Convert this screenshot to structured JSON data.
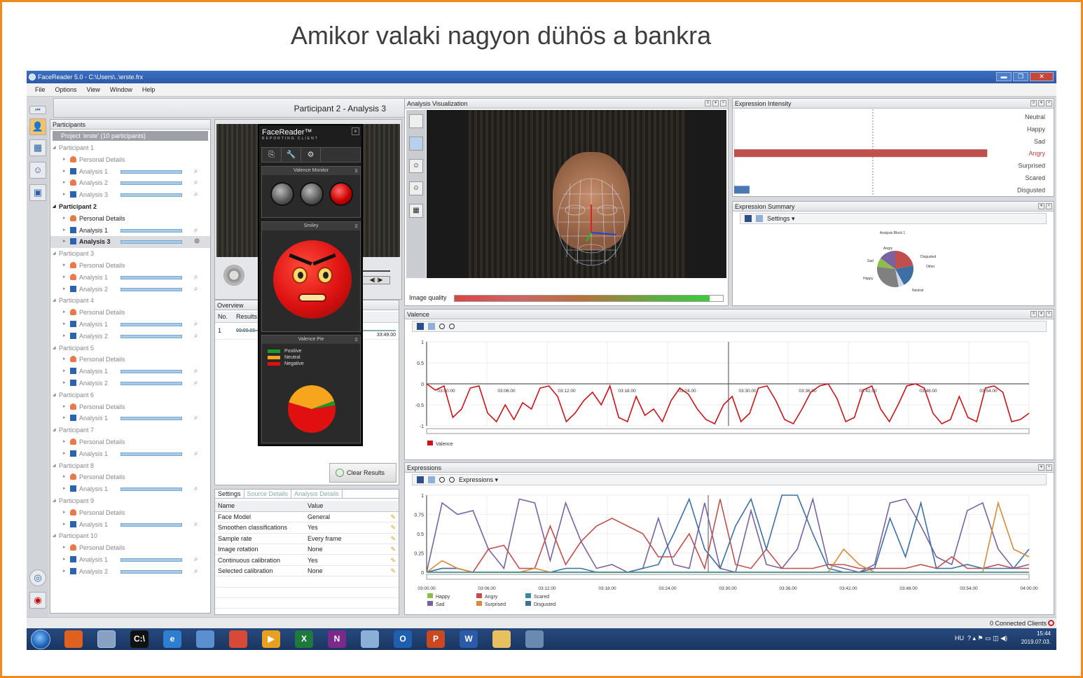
{
  "slide_title": "Amikor valaki nagyon dühös a bankra",
  "window": {
    "title": "FaceReader 5.0 - C:\\Users\\..\\erste.frx",
    "controls": [
      "▬",
      "❐",
      "✕"
    ]
  },
  "menu": [
    "File",
    "Options",
    "View",
    "Window",
    "Help"
  ],
  "header": {
    "title": "Participant 2 - Analysis 3"
  },
  "participants_panel": {
    "title": "Participants",
    "project": "Project 'erste' (10 participants)",
    "rows": [
      {
        "kind": "part",
        "label": "Participant 1",
        "bold": false
      },
      {
        "kind": "child",
        "icon": "person",
        "label": "Personal Details",
        "bar": false
      },
      {
        "kind": "child",
        "icon": "film",
        "label": "Analysis 1",
        "bar": true
      },
      {
        "kind": "child",
        "icon": "person",
        "label": "Analysis 2",
        "bar": true
      },
      {
        "kind": "child",
        "icon": "film",
        "label": "Analysis 3",
        "bar": true
      },
      {
        "kind": "part",
        "label": "Participant 2",
        "bold": true
      },
      {
        "kind": "child",
        "icon": "person",
        "label": "Personal Details",
        "bar": false,
        "dark": true
      },
      {
        "kind": "child",
        "icon": "film",
        "label": "Analysis 1",
        "bar": true,
        "dark": true
      },
      {
        "kind": "child",
        "icon": "film",
        "label": "Analysis 3",
        "bar": true,
        "selected": true
      },
      {
        "kind": "part",
        "label": "Participant 3",
        "bold": false
      },
      {
        "kind": "child",
        "icon": "person",
        "label": "Personal Details",
        "bar": false
      },
      {
        "kind": "child",
        "icon": "person",
        "label": "Analysis 1",
        "bar": true
      },
      {
        "kind": "child",
        "icon": "film",
        "label": "Analysis 2",
        "bar": true
      },
      {
        "kind": "part",
        "label": "Participant 4",
        "bold": false
      },
      {
        "kind": "child",
        "icon": "person",
        "label": "Personal Details",
        "bar": false
      },
      {
        "kind": "child",
        "icon": "film",
        "label": "Analysis 1",
        "bar": true
      },
      {
        "kind": "child",
        "icon": "film",
        "label": "Analysis 2",
        "bar": true
      },
      {
        "kind": "part",
        "label": "Participant 5",
        "bold": false
      },
      {
        "kind": "child",
        "icon": "person",
        "label": "Personal Details",
        "bar": false
      },
      {
        "kind": "child",
        "icon": "film",
        "label": "Analysis 1",
        "bar": true
      },
      {
        "kind": "child",
        "icon": "film",
        "label": "Analysis 2",
        "bar": true
      },
      {
        "kind": "part",
        "label": "Participant 6",
        "bold": false
      },
      {
        "kind": "child",
        "icon": "person",
        "label": "Personal Details",
        "bar": false
      },
      {
        "kind": "child",
        "icon": "film",
        "label": "Analysis 1",
        "bar": true
      },
      {
        "kind": "part",
        "label": "Participant 7",
        "bold": false
      },
      {
        "kind": "child",
        "icon": "person",
        "label": "Personal Details",
        "bar": false
      },
      {
        "kind": "child",
        "icon": "film",
        "label": "Analysis 1",
        "bar": true
      },
      {
        "kind": "part",
        "label": "Participant 8",
        "bold": false
      },
      {
        "kind": "child",
        "icon": "person",
        "label": "Personal Details",
        "bar": false
      },
      {
        "kind": "child",
        "icon": "film",
        "label": "Analysis 1",
        "bar": true
      },
      {
        "kind": "part",
        "label": "Participant 9",
        "bold": false
      },
      {
        "kind": "child",
        "icon": "person",
        "label": "Personal Details",
        "bar": false
      },
      {
        "kind": "child",
        "icon": "film",
        "label": "Analysis 1",
        "bar": true
      },
      {
        "kind": "part",
        "label": "Participant 10",
        "bold": false
      },
      {
        "kind": "child",
        "icon": "person",
        "label": "Personal Details",
        "bar": false
      },
      {
        "kind": "child",
        "icon": "film",
        "label": "Analysis 1",
        "bar": true
      },
      {
        "kind": "child",
        "icon": "film",
        "label": "Analysis 2",
        "bar": true
      }
    ]
  },
  "reporting_client": {
    "title": "FaceReader™",
    "subtitle": "REPORTING CLIENT",
    "valence_monitor": "Valence Monitor",
    "smiley": "Smiley",
    "valence_pie": "Valence Pie",
    "legend": [
      {
        "label": "Positive",
        "color": "#1a9a2a"
      },
      {
        "label": "Neutral",
        "color": "#f7a51d"
      },
      {
        "label": "Negative",
        "color": "#e01010"
      }
    ],
    "pie": {
      "Negative": 0.57,
      "Neutral": 0.4,
      "Positive": 0.03
    }
  },
  "overview": {
    "title": "Overview",
    "headers": [
      "No.",
      "Results"
    ],
    "row_no": "1",
    "start": "00:00.00",
    "end": "33:49.00",
    "clear_button": "Clear Results"
  },
  "settings_panel": {
    "tabs": [
      "Settings",
      "Source Details",
      "Analysis Details"
    ],
    "headers": [
      "Name",
      "Value"
    ],
    "rows": [
      [
        "Face Model",
        "General"
      ],
      [
        "Smoothen classifications",
        "Yes"
      ],
      [
        "Sample rate",
        "Every frame"
      ],
      [
        "Image rotation",
        "None"
      ],
      [
        "Continuous calibration",
        "Yes"
      ],
      [
        "Selected calibration",
        "None"
      ]
    ]
  },
  "analysis_visualization": {
    "title": "Analysis Visualization",
    "image_quality_label": "Image quality",
    "image_quality": 0.95
  },
  "expression_intensity": {
    "title": "Expression Intensity",
    "labels": [
      "Neutral",
      "Happy",
      "Sad",
      "Angry",
      "Surprised",
      "Scared",
      "Disgusted"
    ],
    "values": [
      0.0,
      0.0,
      0.0,
      0.99,
      0.0,
      0.0,
      0.06
    ],
    "colors": [
      "#2d6bb0",
      "#6aa84f",
      "#8e6aa8",
      "#c0504d",
      "#e08040",
      "#3a8a9a",
      "#4a78b0"
    ]
  },
  "expression_summary": {
    "title": "Expression Summary",
    "toolbar_label": "Settings",
    "pie_title": "Analysis Block 1",
    "pie_labels": [
      "Angry",
      "Disgusted",
      "Other",
      "Neutral",
      "Happy",
      "Sad"
    ]
  },
  "valence_chart": {
    "title": "Valence",
    "legend": "Valence"
  },
  "expressions_chart": {
    "title": "Expressions",
    "toolbar_label": "Expressions",
    "legend": [
      "Happy",
      "Angry",
      "Scared",
      "Sad",
      "Surprised",
      "Disgusted"
    ]
  },
  "chart_data": [
    {
      "type": "line",
      "title": "Valence",
      "x": [
        "03:00.00",
        "03:06.00",
        "03:12.00",
        "03:18.00",
        "03:24.00",
        "03:30.00",
        "03:36.00",
        "03:42.00",
        "03:48.00",
        "03:54.00"
      ],
      "ylim": [
        -1,
        1
      ],
      "yticks": [
        "1",
        "0.5",
        "0",
        "-0.5",
        "-1"
      ],
      "series": [
        {
          "name": "Valence",
          "color": "#c8141a",
          "values": [
            0.0,
            -0.15,
            -0.05,
            -0.8,
            -0.6,
            -0.1,
            -0.05,
            -0.7,
            -0.9,
            -0.5,
            -0.85,
            -0.45,
            -0.6,
            -0.1,
            -0.05,
            -0.3,
            -0.9,
            -0.7,
            -0.4,
            -0.2,
            -0.5,
            -0.05,
            -0.8,
            -0.9,
            -0.3,
            -0.75,
            -0.6,
            -0.9,
            -0.4,
            -0.1,
            -0.25,
            -0.6,
            -0.85,
            -0.95,
            -0.5,
            -0.3,
            -0.9,
            -0.7,
            -0.1,
            -0.05,
            -0.4,
            -0.85,
            -0.95,
            -0.6,
            -0.2,
            -0.05,
            0.0,
            -0.35,
            -0.9,
            -0.8,
            -0.15,
            -0.05,
            -0.6,
            -0.9,
            -0.5,
            -0.05,
            0.0,
            -0.1,
            -0.7,
            -0.95,
            -0.85,
            -0.3,
            -0.8,
            -0.9,
            -0.1,
            -0.05,
            -0.2,
            -0.9,
            -0.85,
            -0.7
          ]
        }
      ]
    },
    {
      "type": "line",
      "title": "Expressions",
      "x": [
        "03:00.00",
        "03:06.00",
        "03:12.00",
        "03:18.00",
        "03:24.00",
        "03:30.00",
        "03:36.00",
        "03:42.00",
        "03:48.00",
        "03:54.00",
        "04:00.00"
      ],
      "ylim": [
        0,
        1
      ],
      "yticks": [
        "1",
        "0.75",
        "0.5",
        "0.25",
        "0"
      ],
      "series": [
        {
          "name": "Sad",
          "color": "#7a62a0",
          "values": [
            0.0,
            0.9,
            0.75,
            0.8,
            0.3,
            0.05,
            0.95,
            0.9,
            0.15,
            0.9,
            0.4,
            0.05,
            0.1,
            0.0,
            0.05,
            0.7,
            0.1,
            0.05,
            0.9,
            0.05,
            0.0,
            0.8,
            0.1,
            0.05,
            0.3,
            0.95,
            0.1,
            0.05,
            0.0,
            0.1,
            0.9,
            0.95,
            0.6,
            0.2,
            0.1,
            0.8,
            0.9,
            0.3,
            0.05,
            0.1
          ]
        },
        {
          "name": "Angry",
          "color": "#c0504d",
          "values": [
            0.0,
            0.05,
            0.05,
            0.0,
            0.3,
            0.35,
            0.05,
            0.05,
            0.6,
            0.1,
            0.4,
            0.6,
            0.7,
            0.6,
            0.5,
            0.2,
            0.2,
            0.5,
            0.05,
            0.95,
            0.1,
            0.05,
            0.3,
            0.05,
            0.05,
            0.05,
            0.1,
            0.1,
            0.05,
            0.05,
            0.05,
            0.05,
            0.1,
            0.05,
            0.2,
            0.05,
            0.05,
            0.1,
            0.05,
            0.05
          ]
        },
        {
          "name": "Disgusted",
          "color": "#3d6fa5",
          "values": [
            0.0,
            0.05,
            0.05,
            0.0,
            0.0,
            0.0,
            0.0,
            0.0,
            0.0,
            0.05,
            0.05,
            0.0,
            0.0,
            0.0,
            0.05,
            0.1,
            0.5,
            0.95,
            0.3,
            0.05,
            0.6,
            0.95,
            0.3,
            1.0,
            1.0,
            0.5,
            0.05,
            0.0,
            0.0,
            0.05,
            0.7,
            0.2,
            0.9,
            0.05,
            0.05,
            0.1,
            0.05,
            0.05,
            0.05,
            0.3
          ]
        },
        {
          "name": "Surprised",
          "color": "#d78a3a",
          "values": [
            0.0,
            0.15,
            0.05,
            0.0,
            0.0,
            0.0,
            0.0,
            0.05,
            0.0,
            0.0,
            0.0,
            0.0,
            0.0,
            0.0,
            0.0,
            0.0,
            0.0,
            0.0,
            0.0,
            0.0,
            0.0,
            0.0,
            0.0,
            0.0,
            0.0,
            0.0,
            0.0,
            0.3,
            0.1,
            0.0,
            0.0,
            0.0,
            0.0,
            0.0,
            0.0,
            0.0,
            0.0,
            0.9,
            0.3,
            0.2
          ]
        },
        {
          "name": "Happy",
          "color": "#8bbf4a",
          "values": [
            0.0,
            0.0,
            0.0,
            0.0,
            0.0,
            0.0,
            0.0,
            0.0,
            0.0,
            0.0,
            0.0,
            0.0,
            0.0,
            0.0,
            0.0,
            0.0,
            0.0,
            0.0,
            0.0,
            0.0,
            0.0,
            0.0,
            0.0,
            0.0,
            0.0,
            0.0,
            0.0,
            0.0,
            0.0,
            0.0,
            0.0,
            0.0,
            0.0,
            0.0,
            0.0,
            0.0,
            0.0,
            0.0,
            0.0,
            0.0
          ]
        },
        {
          "name": "Scared",
          "color": "#3a8a9a",
          "values": [
            0.0,
            0.0,
            0.0,
            0.0,
            0.0,
            0.0,
            0.0,
            0.0,
            0.0,
            0.0,
            0.0,
            0.0,
            0.0,
            0.0,
            0.0,
            0.0,
            0.0,
            0.0,
            0.0,
            0.0,
            0.0,
            0.0,
            0.0,
            0.0,
            0.0,
            0.0,
            0.0,
            0.0,
            0.0,
            0.0,
            0.0,
            0.0,
            0.0,
            0.0,
            0.0,
            0.0,
            0.0,
            0.0,
            0.0,
            0.0
          ]
        }
      ]
    }
  ],
  "status": {
    "connected": "0 Connected Clients"
  },
  "taskbar": {
    "language": "HU",
    "time": "15:44",
    "date": "2019.07.03.",
    "apps": [
      {
        "name": "firefox-icon",
        "glyph": "",
        "color": "#e06020"
      },
      {
        "name": "facereader-icon",
        "glyph": "",
        "color": "#8aa0c0"
      },
      {
        "name": "terminal-icon",
        "glyph": "C:\\",
        "color": "#111"
      },
      {
        "name": "ie-icon",
        "glyph": "e",
        "color": "#2e7fd0"
      },
      {
        "name": "globe-app-icon",
        "glyph": "",
        "color": "#5a8fd0"
      },
      {
        "name": "chrome-icon",
        "glyph": "",
        "color": "#d84a38"
      },
      {
        "name": "media-icon",
        "glyph": "▶",
        "color": "#e8a020"
      },
      {
        "name": "excel-icon",
        "glyph": "X",
        "color": "#1e7a3c"
      },
      {
        "name": "onenote-icon",
        "glyph": "N",
        "color": "#7a2a8a"
      },
      {
        "name": "paint-icon",
        "glyph": "",
        "color": "#8ab0d8"
      },
      {
        "name": "outlook-icon",
        "glyph": "O",
        "color": "#1f5fb0"
      },
      {
        "name": "powerpoint-icon",
        "glyph": "P",
        "color": "#c84820"
      },
      {
        "name": "word-icon",
        "glyph": "W",
        "color": "#2a5aa8"
      },
      {
        "name": "folder-icon",
        "glyph": "",
        "color": "#e8c060"
      },
      {
        "name": "network-app-icon",
        "glyph": "",
        "color": "#6a8ab0"
      }
    ]
  }
}
